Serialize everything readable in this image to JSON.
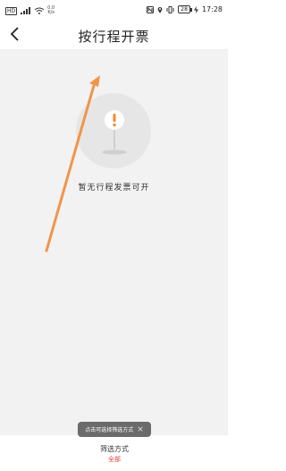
{
  "status_bar": {
    "sig_label": "HD",
    "net_speed_top": "0.0",
    "net_speed_bottom": "K/s",
    "battery": "28",
    "time": "17:28"
  },
  "nav": {
    "title": "按行程开票"
  },
  "empty_state": {
    "icon_name": "alert-icon",
    "message": "暂无行程发票可开"
  },
  "toast": {
    "message": "点击可选择筛选方式",
    "close_icon": "×"
  },
  "bottom": {
    "filter_label": "筛选方式",
    "filter_value": "全部"
  },
  "colors": {
    "accent_red": "#e8413d",
    "annotation_arrow": "#f0954a",
    "background_gray": "#f2f2f2"
  }
}
